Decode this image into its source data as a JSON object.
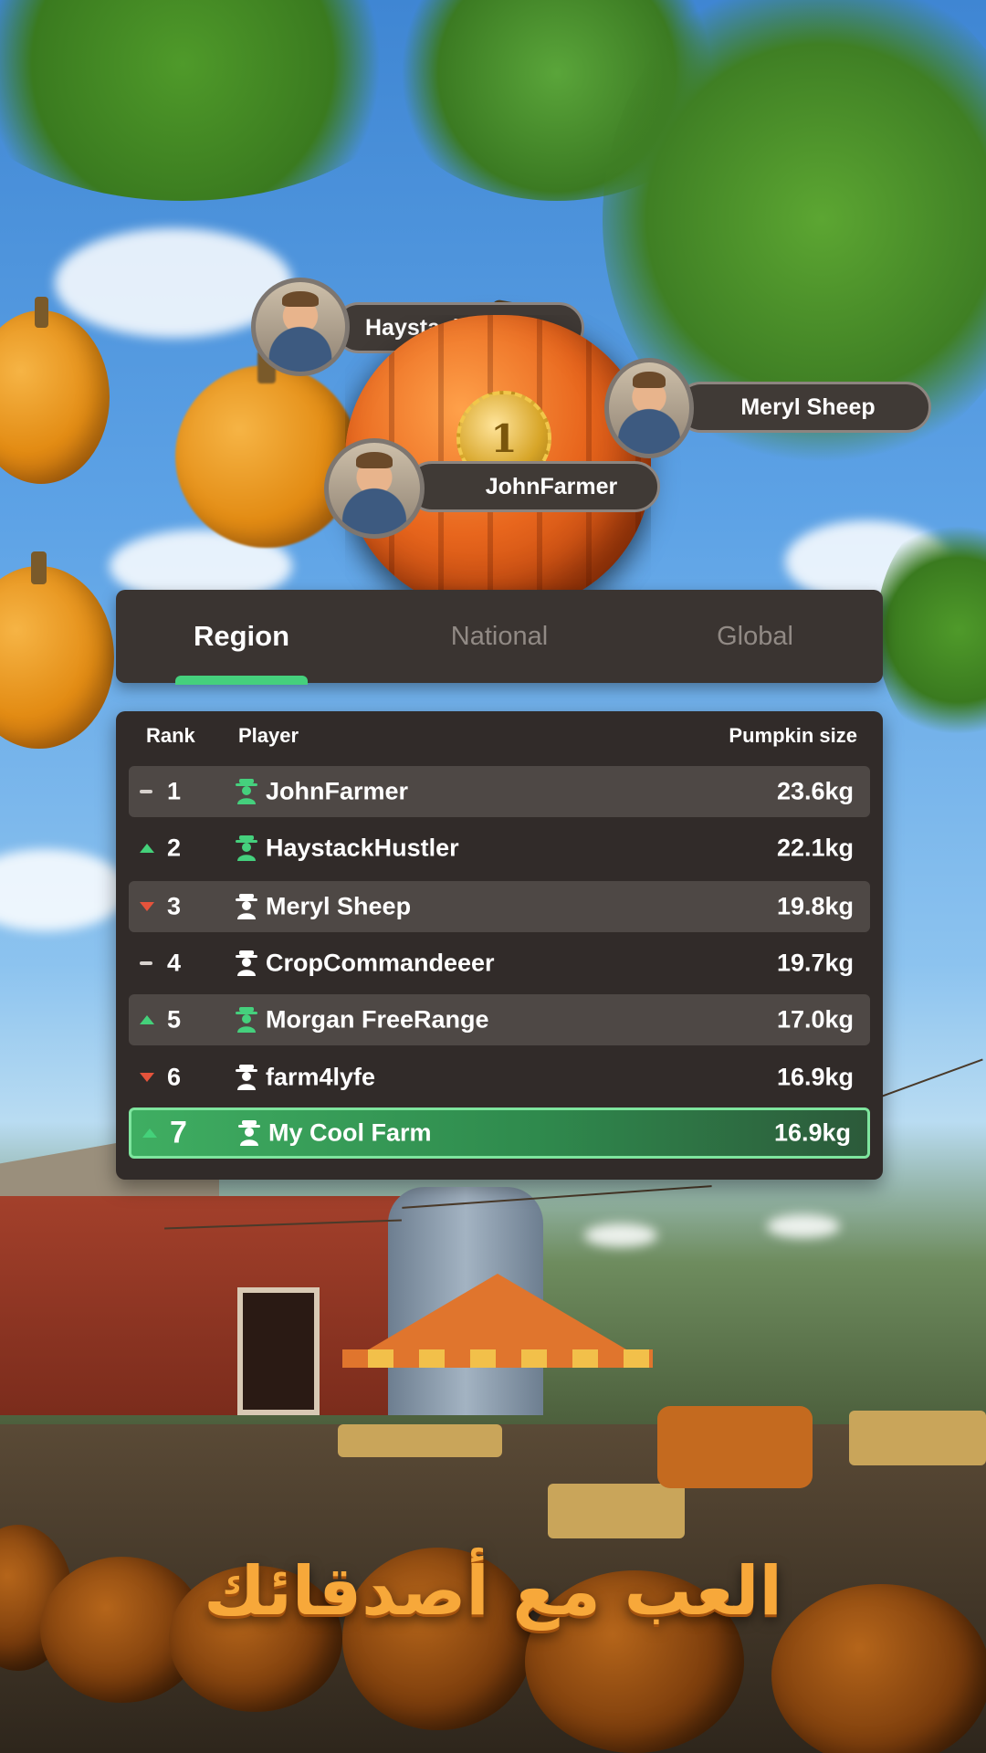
{
  "podium": [
    {
      "name": "HaystackHustler"
    },
    {
      "name": "Meryl Sheep"
    },
    {
      "name": "JohnFarmer"
    }
  ],
  "medal": {
    "label": "1"
  },
  "tabs": [
    {
      "label": "Region",
      "active": true
    },
    {
      "label": "National",
      "active": false
    },
    {
      "label": "Global",
      "active": false
    }
  ],
  "leaderboard": {
    "headers": {
      "rank": "Rank",
      "player": "Player",
      "size": "Pumpkin size"
    },
    "rows": [
      {
        "rank": "1",
        "trend": "same",
        "icon": "farmer-icon-green",
        "name": "JohnFarmer",
        "size": "23.6kg"
      },
      {
        "rank": "2",
        "trend": "up",
        "icon": "farmer-icon-green",
        "name": "HaystackHustler",
        "size": "22.1kg"
      },
      {
        "rank": "3",
        "trend": "down",
        "icon": "farmer-icon-white",
        "name": "Meryl Sheep",
        "size": "19.8kg"
      },
      {
        "rank": "4",
        "trend": "same",
        "icon": "farmer-icon-white",
        "name": "CropCommandeeer",
        "size": "19.7kg"
      },
      {
        "rank": "5",
        "trend": "up",
        "icon": "farmer-icon-green",
        "name": "Morgan FreeRange",
        "size": "17.0kg"
      },
      {
        "rank": "6",
        "trend": "down",
        "icon": "farmer-icon-white",
        "name": "farm4lyfe",
        "size": "16.9kg"
      },
      {
        "rank": "7",
        "trend": "up",
        "icon": "farmer-icon-white",
        "name": "My Cool Farm",
        "size": "16.9kg",
        "current_user": true
      }
    ]
  },
  "caption": "العب مع أصدقائك",
  "colors": {
    "accent_green": "#45d07d",
    "trend_up": "#44d17a",
    "trend_down": "#e5533b",
    "caption_orange": "#f7a83a",
    "panel": "#312b29"
  }
}
